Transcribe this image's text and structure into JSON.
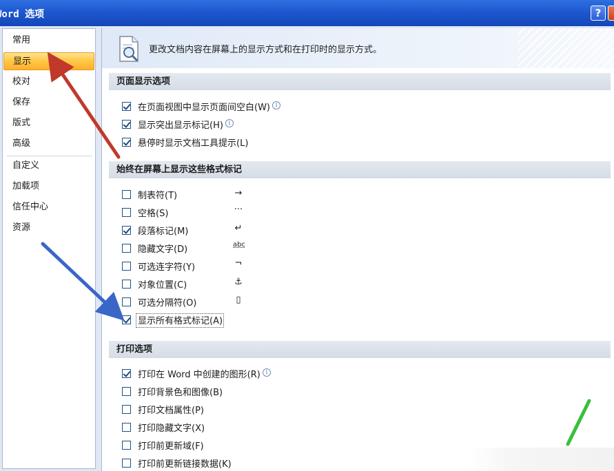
{
  "window": {
    "title": "Word 选项",
    "help_label": "?"
  },
  "nav": {
    "items": [
      {
        "label": "常用",
        "selected": false
      },
      {
        "label": "显示",
        "selected": true
      },
      {
        "label": "校对",
        "selected": false
      },
      {
        "label": "保存",
        "selected": false
      },
      {
        "label": "版式",
        "selected": false
      },
      {
        "label": "高级",
        "selected": false
      },
      {
        "label": "自定义",
        "selected": false
      },
      {
        "label": "加载项",
        "selected": false
      },
      {
        "label": "信任中心",
        "selected": false
      },
      {
        "label": "资源",
        "selected": false
      }
    ]
  },
  "banner": {
    "text": "更改文档内容在屏幕上的显示方式和在打印时的显示方式。",
    "icon": "document-magnifier-icon"
  },
  "sections": [
    {
      "title": "页面显示选项",
      "options": [
        {
          "label": "在页面视图中显示页面间空白(W)",
          "checked": true,
          "info": true
        },
        {
          "label": "显示突出显示标记(H)",
          "checked": true,
          "info": true
        },
        {
          "label": "悬停时显示文档工具提示(L)",
          "checked": true,
          "info": false
        }
      ]
    },
    {
      "title": "始终在屏幕上显示这些格式标记",
      "options": [
        {
          "label": "制表符(T)",
          "checked": false,
          "mark": "→"
        },
        {
          "label": "空格(S)",
          "checked": false,
          "mark": "···"
        },
        {
          "label": "段落标记(M)",
          "checked": true,
          "mark": "↵"
        },
        {
          "label": "隐藏文字(D)",
          "checked": false,
          "mark": "abc"
        },
        {
          "label": "可选连字符(Y)",
          "checked": false,
          "mark": "¬"
        },
        {
          "label": "对象位置(C)",
          "checked": false,
          "mark": "⚓"
        },
        {
          "label": "可选分隔符(O)",
          "checked": false,
          "mark": "▯"
        },
        {
          "label": "显示所有格式标记(A)",
          "checked": true,
          "mark": ""
        }
      ]
    },
    {
      "title": "打印选项",
      "options": [
        {
          "label": "打印在 Word 中创建的图形(R)",
          "checked": true,
          "info": true
        },
        {
          "label": "打印背景色和图像(B)",
          "checked": false,
          "info": false
        },
        {
          "label": "打印文档属性(P)",
          "checked": false,
          "info": false
        },
        {
          "label": "打印隐藏文字(X)",
          "checked": false,
          "info": false
        },
        {
          "label": "打印前更新域(F)",
          "checked": false,
          "info": false
        },
        {
          "label": "打印前更新链接数据(K)",
          "checked": false,
          "info": false
        }
      ]
    }
  ],
  "colors": {
    "accent_selected": "#ffc94a",
    "titlebar": "#1d58d0",
    "arrow_red": "#c0392b",
    "arrow_blue": "#3a66c8",
    "arrow_green": "#3bbf3b"
  }
}
